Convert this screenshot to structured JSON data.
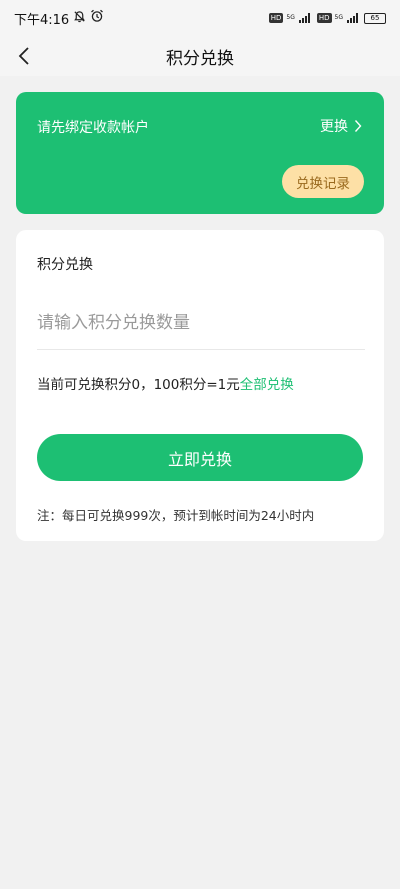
{
  "status_bar": {
    "time": "下午4:16",
    "hd1": "HD",
    "net1": "5G",
    "hd2": "HD",
    "net2": "5G",
    "battery": "65"
  },
  "header": {
    "title": "积分兑换"
  },
  "account": {
    "bind_prompt": "请先绑定收款帐户",
    "change_label": "更换",
    "records_label": "兑换记录"
  },
  "exchange": {
    "section_title": "积分兑换",
    "input_placeholder": "请输入积分兑换数量",
    "input_value": "",
    "info_text": "当前可兑换积分0，100积分=1元",
    "all_label": "全部兑换",
    "submit_label": "立即兑换",
    "note": "注：每日可兑换999次，预计到帐时间为24小时内"
  },
  "colors": {
    "brand": "#1dbf73",
    "records_bg": "#fde0a6",
    "records_text": "#9a6a1e"
  }
}
